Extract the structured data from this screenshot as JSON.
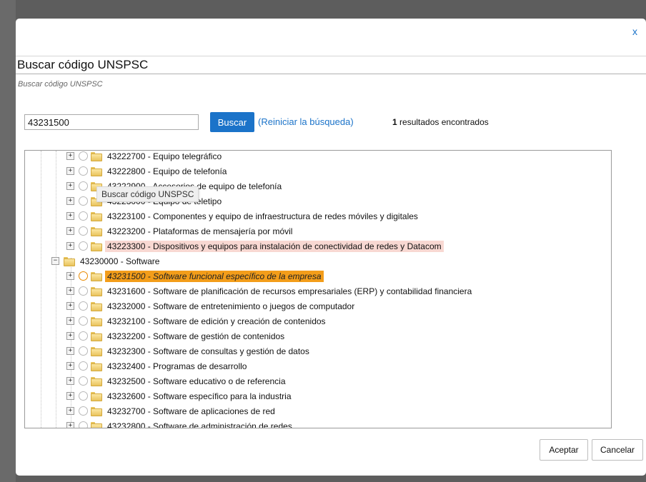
{
  "dialog": {
    "close_label": "x",
    "title": "Buscar código UNSPSC",
    "subtitle": "Buscar código UNSPSC"
  },
  "search": {
    "value": "43231500",
    "button_label": "Buscar",
    "reset_label": "(Reiniciar la búsqueda)",
    "result_count": "1",
    "result_text": " resultados encontrados"
  },
  "tooltip": "Buscar código UNSPSC",
  "tree": {
    "rows": [
      {
        "label": "43222700 - Equipo telegráfico"
      },
      {
        "label": "43222800 - Equipo de telefonía"
      },
      {
        "label": "43222900 - Accesorios de equipo de telefonía"
      },
      {
        "label": "43223000 - Equipo de teletipo"
      },
      {
        "label": "43223100 - Componentes y equipo de infraestructura de redes móviles y digitales"
      },
      {
        "label": "43223200 - Plataformas de mensajería por móvil"
      },
      {
        "label": "43223300 - Dispositivos y equipos para instalación de conectividad de redes y Datacom"
      },
      {
        "label": "43230000 - Software"
      },
      {
        "label": "43231500 - Software funcional específico de la empresa"
      },
      {
        "label": "43231600 - Software de planificación de recursos empresariales (ERP) y contabilidad financiera"
      },
      {
        "label": "43232000 - Software de entretenimiento o juegos de computador"
      },
      {
        "label": "43232100 - Software de edición y creación de contenidos"
      },
      {
        "label": "43232200 - Software de gestión de contenidos"
      },
      {
        "label": "43232300 - Software de consultas y gestión de datos"
      },
      {
        "label": "43232400 - Programas de desarrollo"
      },
      {
        "label": "43232500 - Software educativo o de referencia"
      },
      {
        "label": "43232600 - Software específico para la industria"
      },
      {
        "label": "43232700 - Software de aplicaciones de red"
      },
      {
        "label": "43232800 - Software de administración de redes"
      }
    ]
  },
  "footer": {
    "accept_label": "Aceptar",
    "cancel_label": "Cancelar"
  },
  "colors": {
    "accent": "#1b73c9",
    "selected_highlight": "#f39d1a",
    "hover_highlight": "#f8d8d2"
  }
}
